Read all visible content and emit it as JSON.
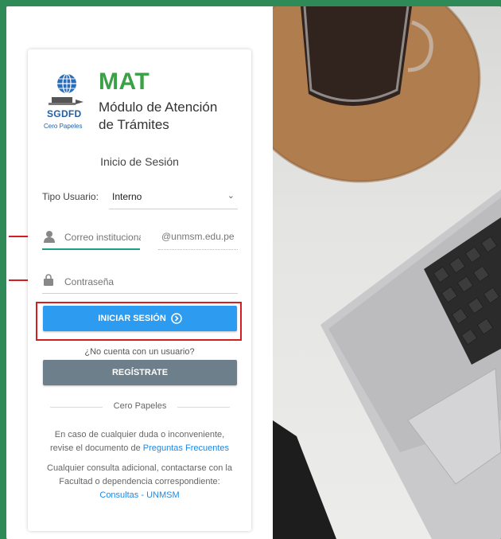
{
  "brand": {
    "sgdfd": "SGDFD",
    "cero_papeles": "Cero Papeles",
    "app_short": "MAT",
    "app_line1": "Módulo de Atención",
    "app_line2": "de Trámites"
  },
  "login": {
    "title": "Inicio de Sesión",
    "user_type_label": "Tipo Usuario:",
    "user_type_value": "Interno",
    "email_placeholder": "Correo institucional",
    "email_domain": "@unmsm.edu.pe",
    "password_placeholder": "Contraseña",
    "login_button": "INICIAR SESIÓN",
    "no_account": "¿No cuenta con un usuario?",
    "register_button": "REGÍSTRATE",
    "divider_text": "Cero Papeles"
  },
  "info": {
    "line1": "En caso de cualquier duda o inconveniente,",
    "line2_prefix": "revise el documento de ",
    "faq_link": "Preguntas Frecuentes",
    "line3": "Cualquier consulta adicional, contactarse con la",
    "line4": "Facultad o dependencia correspondiente:",
    "contact_link": "Consultas - UNMSM"
  },
  "colors": {
    "page_border": "#2e8b57",
    "brand_green": "#3aa146",
    "primary_blue": "#2d9cf0",
    "register_gray": "#6c7f8a",
    "highlight_red": "#d51e1e",
    "focus_teal": "#1a9e8a"
  }
}
